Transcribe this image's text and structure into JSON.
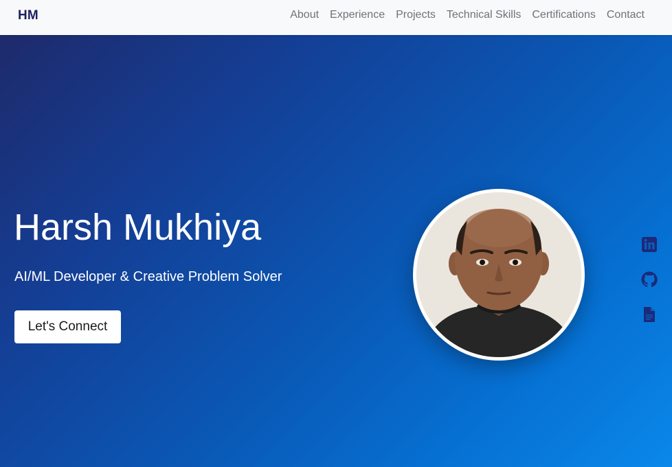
{
  "nav": {
    "brand": "HM",
    "links": [
      {
        "label": "About"
      },
      {
        "label": "Experience"
      },
      {
        "label": "Projects"
      },
      {
        "label": "Technical Skills"
      },
      {
        "label": "Certifications"
      },
      {
        "label": "Contact"
      }
    ]
  },
  "hero": {
    "name": "Harsh Mukhiya",
    "tagline": "AI/ML Developer & Creative Problem Solver",
    "cta_label": "Let's Connect"
  },
  "social": [
    {
      "icon": "linkedin-icon"
    },
    {
      "icon": "github-icon"
    },
    {
      "icon": "document-icon"
    }
  ],
  "colors": {
    "brand": "#1f2163",
    "nav_text": "#6f7276",
    "gradient_start": "#1e2a6b",
    "gradient_end": "#0a88ea",
    "social_icons": "#1b2a7a"
  }
}
